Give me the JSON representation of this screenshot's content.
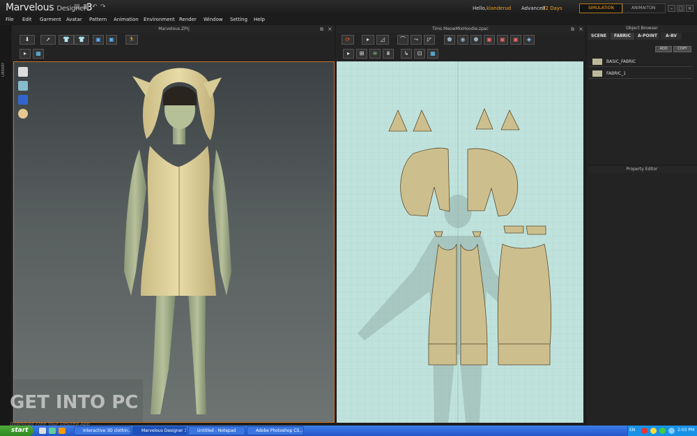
{
  "titlebar": {
    "app_name": "Marvelous",
    "app_sub": "Designer",
    "app_ver": "3",
    "hello": "Hello,",
    "username": "klanderud",
    "license": "Advanced",
    "days": "22 Days",
    "simulation": "SIMULATION",
    "animation": "ANIMAITON"
  },
  "menu": [
    "File",
    "Edit",
    "Garment",
    "Avatar",
    "Pattern",
    "Animation",
    "Environment",
    "Render",
    "Window",
    "Setting",
    "Help"
  ],
  "library_label": "LIBRARY",
  "panel3d": {
    "title": "Marvelous.ZPrj"
  },
  "panel2d": {
    "title": "Tims MeowMixHoodie.zpac"
  },
  "watermark": {
    "main": "GET INTO PC",
    "sub": "Download Free Your Desired App"
  },
  "object_browser": {
    "title": "Object Browser",
    "tabs": [
      "SCENE",
      "FABRIC",
      "A-POINT",
      "A-BV"
    ],
    "active_tab": "FABRIC",
    "add": "ADD",
    "copy": "COPY",
    "fabrics": [
      "BASIC_FABRIC",
      "FABRIC_1"
    ]
  },
  "property_editor": {
    "title": "Property Editor"
  },
  "taskbar": {
    "start": "start",
    "tasks": [
      "Interactive 3D clothin...",
      "Marvelous Designer 3...",
      "Untitled - Notepad",
      "Adobe Photoshop CS..."
    ],
    "lang": "EN",
    "clock": "2:03 PM"
  },
  "colors": {
    "accent": "#f0a020",
    "highlight_border": "#c8762a",
    "pattern_bg": "#bfe3dc",
    "fabric": "#c9c190"
  }
}
